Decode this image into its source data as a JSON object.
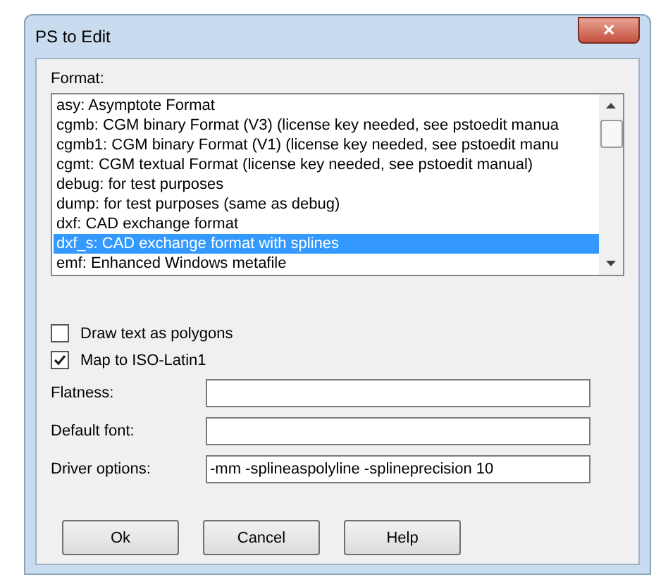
{
  "window": {
    "title": "PS to Edit",
    "close": "✕"
  },
  "format": {
    "label": "Format:",
    "items": [
      {
        "text": "asy:  Asymptote Format",
        "selected": false
      },
      {
        "text": "cgmb:  CGM binary Format (V3) (license key needed, see pstoedit manua",
        "selected": false
      },
      {
        "text": "cgmb1:  CGM binary Format (V1) (license key needed, see pstoedit manu",
        "selected": false
      },
      {
        "text": "cgmt:  CGM textual Format (license key needed, see pstoedit manual)",
        "selected": false
      },
      {
        "text": "debug:  for test purposes",
        "selected": false
      },
      {
        "text": "dump:  for test purposes (same as debug)",
        "selected": false
      },
      {
        "text": "dxf:  CAD exchange format",
        "selected": false
      },
      {
        "text": "dxf_s:  CAD exchange format with splines",
        "selected": true
      },
      {
        "text": "emf:  Enhanced Windows metafile",
        "selected": false
      }
    ]
  },
  "checkboxes": [
    {
      "label": "Draw text as polygons",
      "checked": false
    },
    {
      "label": "Map to ISO-Latin1",
      "checked": true
    }
  ],
  "fields": [
    {
      "label": "Flatness:"
    },
    {
      "label": "Default font:"
    },
    {
      "label": "Driver options:",
      "value": "-mm -splineaspolyline -splineprecision 10"
    }
  ],
  "buttons": [
    "Ok",
    "Cancel",
    "Help"
  ]
}
